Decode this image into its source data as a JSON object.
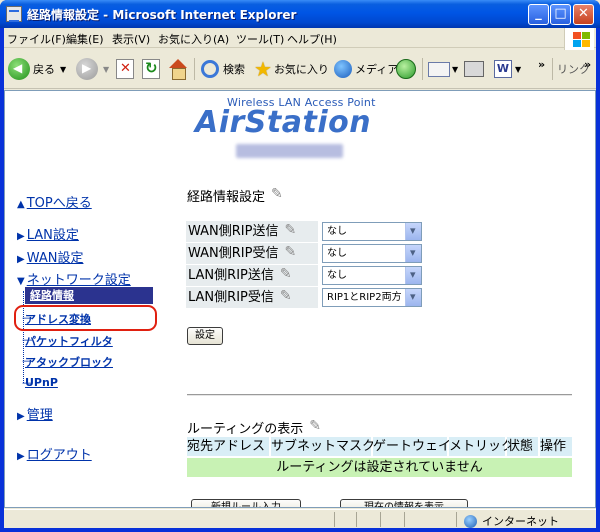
{
  "window": {
    "title": "経路情報設定 - Microsoft Internet Explorer",
    "controls": [
      "minimize",
      "maximize",
      "close"
    ]
  },
  "menubar": {
    "items": [
      "ファイル(F)",
      "編集(E)",
      "表示(V)",
      "お気に入り(A)",
      "ツール(T)",
      "ヘルプ(H)"
    ]
  },
  "toolbar": {
    "back_label": "戻る",
    "search_label": "検索",
    "favorites_label": "お気に入り",
    "media_label": "メディア",
    "links_label": "リンク",
    "overflow_label": "»"
  },
  "header": {
    "subtitle": "Wireless LAN Access Point",
    "brand": "AirStation"
  },
  "nav": {
    "top": "TOPへ戻る",
    "lan": "LAN設定",
    "wan": "WAN設定",
    "network": "ネットワーク設定",
    "network_items": [
      "経路情報",
      "アドレス変換",
      "パケットフィルタ",
      "アタックブロック",
      "UPnP"
    ],
    "management": "管理",
    "logout": "ログアウト"
  },
  "main": {
    "title": "経路情報設定",
    "rip_rows": [
      {
        "label": "WAN側RIP送信",
        "value": "なし"
      },
      {
        "label": "WAN側RIP受信",
        "value": "なし"
      },
      {
        "label": "LAN側RIP送信",
        "value": "なし"
      },
      {
        "label": "LAN側RIP受信",
        "value": "RIP1とRIP2両方"
      }
    ],
    "set_button": "設定",
    "routing_title": "ルーティングの表示",
    "routing_columns": [
      "宛先アドレス",
      "サブネットマスク",
      "ゲートウェイ",
      "メトリック",
      "状態",
      "操作"
    ],
    "routing_empty": "ルーティングは設定されていません",
    "new_rule_button": "新規ルール入力",
    "show_current_button": "現在の情報を表示"
  },
  "statusbar": {
    "zone": "インターネット"
  }
}
